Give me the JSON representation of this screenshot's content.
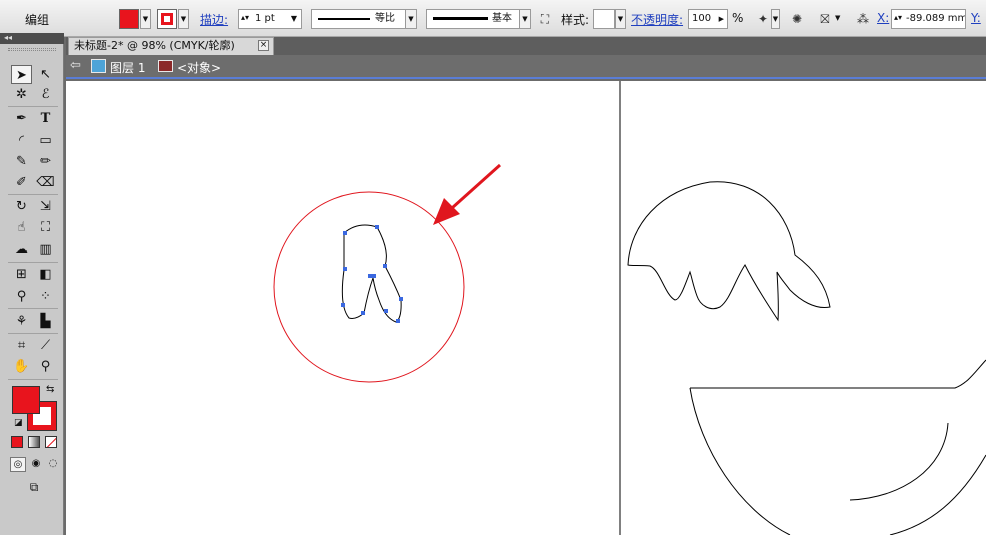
{
  "controlbar": {
    "group_label": "编组",
    "stroke_label": "描边:",
    "stroke_weight": "1 pt",
    "profile_uniform": "等比",
    "brush_basic": "基本",
    "style_label": "样式:",
    "opacity_label": "不透明度:",
    "opacity_value": "100",
    "opacity_unit": "%",
    "x_label": "X:",
    "x_value": "-89.089 mm",
    "y_label": "Y:"
  },
  "document_tab": {
    "title": "未标题-2* @ 98% (CMYK/轮廓)",
    "close": "×"
  },
  "breadcrumb": {
    "layer": "图层 1",
    "object": "<对象>"
  },
  "colors": {
    "fill": "#e8141d",
    "annotation_red": "#e0161e",
    "selection_blue": "#3a68e0"
  },
  "tools": {
    "panel_collapse": "◂◂",
    "items": [
      "selection",
      "direct-selection",
      "magic-wand",
      "lasso",
      "pen",
      "type",
      "arc",
      "rectangle",
      "paintbrush",
      "pencil",
      "blob-brush",
      "eraser",
      "rotate",
      "scale",
      "warp",
      "free-transform",
      "symbol-sprayer",
      "graph",
      "mesh",
      "gradient",
      "eyedropper",
      "blend",
      "live-paint",
      "column-graph",
      "artboard",
      "slice",
      "hand",
      "zoom",
      "fill-stroke",
      "color-mode",
      "draw-mode",
      "screen-mode"
    ]
  }
}
